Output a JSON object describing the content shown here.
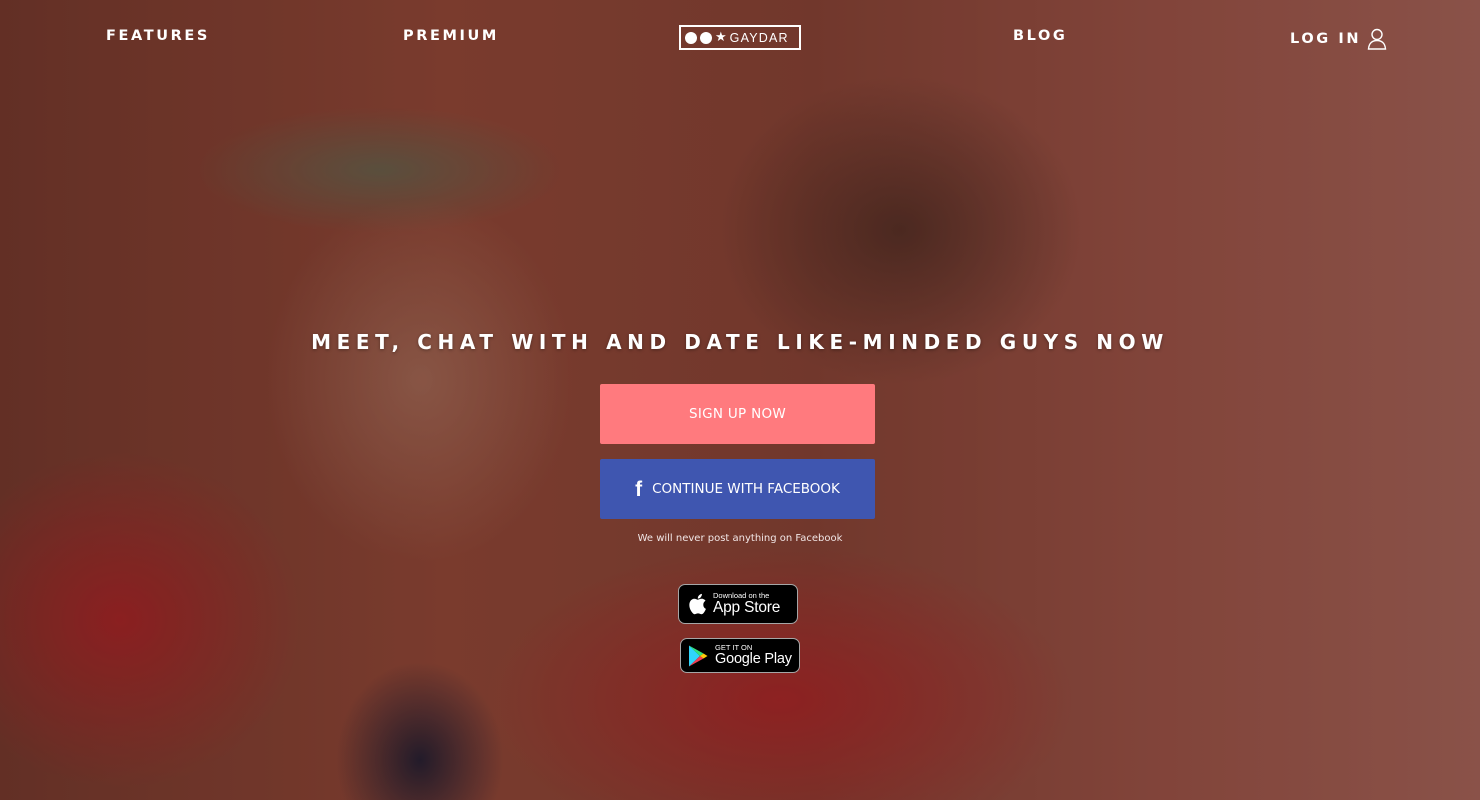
{
  "nav": {
    "features": "FEATURES",
    "premium": "PREMIUM",
    "logo_text": "GAYDAR",
    "blog": "BLOG",
    "login": "LOG IN"
  },
  "hero": {
    "background_image": "photo-two-men-smiling",
    "headline": "MEET, CHAT WITH AND DATE LIKE-MINDED GUYS NOW",
    "signup_label": "SIGN UP NOW",
    "facebook_label": "CONTINUE WITH FACEBOOK",
    "facebook_icon": "facebook-icon",
    "disclaimer": "We will never post anything on Facebook"
  },
  "stores": {
    "appstore_small": "Download on the",
    "appstore_big": "App Store",
    "google_small": "GET IT ON",
    "google_big": "Google Play"
  },
  "colors": {
    "signup": "#ff7a7e",
    "facebook": "#3f56b0"
  }
}
